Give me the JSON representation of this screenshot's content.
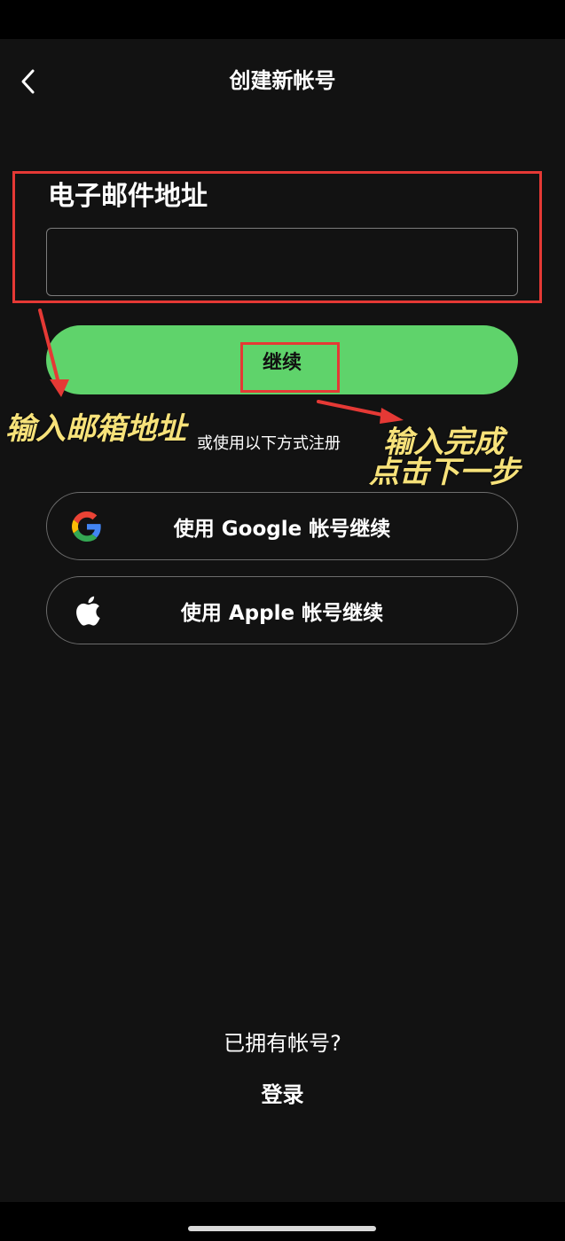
{
  "header": {
    "title": "创建新帐号",
    "back_icon": "chevron-left-icon"
  },
  "form": {
    "email_label": "电子邮件地址",
    "email_value": "",
    "continue_label": "继续"
  },
  "alternatives": {
    "or_text": "或使用以下方式注册",
    "google_label": "使用 Google 帐号继续",
    "apple_label": "使用 Apple 帐号继续"
  },
  "footer": {
    "have_account": "已拥有帐号?",
    "login_label": "登录"
  },
  "annotations": {
    "left": "输入邮箱地址",
    "right_line1": "输入完成",
    "right_line2": "点击下一步"
  },
  "colors": {
    "background": "#121212",
    "accent_green": "#5fd36b",
    "annotation_red": "#e53935",
    "annotation_yellow": "#f7e27a"
  }
}
